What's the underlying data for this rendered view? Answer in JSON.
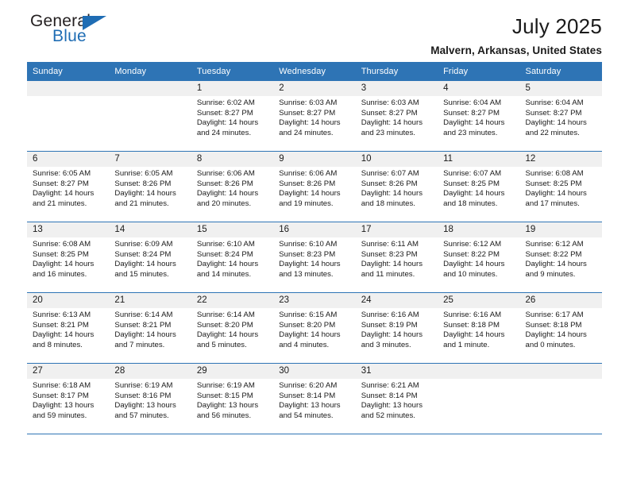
{
  "brand": {
    "name_top": "General",
    "name_bottom": "Blue",
    "color_primary": "#1f6db4"
  },
  "header": {
    "title": "July 2025",
    "subtitle": "Malvern, Arkansas, United States"
  },
  "theme": {
    "header_row_bg": "#2e74b5",
    "daynum_bg": "#f0f0f0",
    "grid_line": "#2e74b5"
  },
  "weekday_headers": [
    "Sunday",
    "Monday",
    "Tuesday",
    "Wednesday",
    "Thursday",
    "Friday",
    "Saturday"
  ],
  "labels": {
    "sunrise_prefix": "Sunrise:",
    "sunset_prefix": "Sunset:",
    "daylight_prefix": "Daylight:"
  },
  "weeks": [
    [
      {
        "day": "",
        "sunrise": "",
        "sunset": "",
        "daylight_line1": "",
        "daylight_line2": ""
      },
      {
        "day": "",
        "sunrise": "",
        "sunset": "",
        "daylight_line1": "",
        "daylight_line2": ""
      },
      {
        "day": "1",
        "sunrise": "Sunrise: 6:02 AM",
        "sunset": "Sunset: 8:27 PM",
        "daylight_line1": "Daylight: 14 hours",
        "daylight_line2": "and 24 minutes."
      },
      {
        "day": "2",
        "sunrise": "Sunrise: 6:03 AM",
        "sunset": "Sunset: 8:27 PM",
        "daylight_line1": "Daylight: 14 hours",
        "daylight_line2": "and 24 minutes."
      },
      {
        "day": "3",
        "sunrise": "Sunrise: 6:03 AM",
        "sunset": "Sunset: 8:27 PM",
        "daylight_line1": "Daylight: 14 hours",
        "daylight_line2": "and 23 minutes."
      },
      {
        "day": "4",
        "sunrise": "Sunrise: 6:04 AM",
        "sunset": "Sunset: 8:27 PM",
        "daylight_line1": "Daylight: 14 hours",
        "daylight_line2": "and 23 minutes."
      },
      {
        "day": "5",
        "sunrise": "Sunrise: 6:04 AM",
        "sunset": "Sunset: 8:27 PM",
        "daylight_line1": "Daylight: 14 hours",
        "daylight_line2": "and 22 minutes."
      }
    ],
    [
      {
        "day": "6",
        "sunrise": "Sunrise: 6:05 AM",
        "sunset": "Sunset: 8:27 PM",
        "daylight_line1": "Daylight: 14 hours",
        "daylight_line2": "and 21 minutes."
      },
      {
        "day": "7",
        "sunrise": "Sunrise: 6:05 AM",
        "sunset": "Sunset: 8:26 PM",
        "daylight_line1": "Daylight: 14 hours",
        "daylight_line2": "and 21 minutes."
      },
      {
        "day": "8",
        "sunrise": "Sunrise: 6:06 AM",
        "sunset": "Sunset: 8:26 PM",
        "daylight_line1": "Daylight: 14 hours",
        "daylight_line2": "and 20 minutes."
      },
      {
        "day": "9",
        "sunrise": "Sunrise: 6:06 AM",
        "sunset": "Sunset: 8:26 PM",
        "daylight_line1": "Daylight: 14 hours",
        "daylight_line2": "and 19 minutes."
      },
      {
        "day": "10",
        "sunrise": "Sunrise: 6:07 AM",
        "sunset": "Sunset: 8:26 PM",
        "daylight_line1": "Daylight: 14 hours",
        "daylight_line2": "and 18 minutes."
      },
      {
        "day": "11",
        "sunrise": "Sunrise: 6:07 AM",
        "sunset": "Sunset: 8:25 PM",
        "daylight_line1": "Daylight: 14 hours",
        "daylight_line2": "and 18 minutes."
      },
      {
        "day": "12",
        "sunrise": "Sunrise: 6:08 AM",
        "sunset": "Sunset: 8:25 PM",
        "daylight_line1": "Daylight: 14 hours",
        "daylight_line2": "and 17 minutes."
      }
    ],
    [
      {
        "day": "13",
        "sunrise": "Sunrise: 6:08 AM",
        "sunset": "Sunset: 8:25 PM",
        "daylight_line1": "Daylight: 14 hours",
        "daylight_line2": "and 16 minutes."
      },
      {
        "day": "14",
        "sunrise": "Sunrise: 6:09 AM",
        "sunset": "Sunset: 8:24 PM",
        "daylight_line1": "Daylight: 14 hours",
        "daylight_line2": "and 15 minutes."
      },
      {
        "day": "15",
        "sunrise": "Sunrise: 6:10 AM",
        "sunset": "Sunset: 8:24 PM",
        "daylight_line1": "Daylight: 14 hours",
        "daylight_line2": "and 14 minutes."
      },
      {
        "day": "16",
        "sunrise": "Sunrise: 6:10 AM",
        "sunset": "Sunset: 8:23 PM",
        "daylight_line1": "Daylight: 14 hours",
        "daylight_line2": "and 13 minutes."
      },
      {
        "day": "17",
        "sunrise": "Sunrise: 6:11 AM",
        "sunset": "Sunset: 8:23 PM",
        "daylight_line1": "Daylight: 14 hours",
        "daylight_line2": "and 11 minutes."
      },
      {
        "day": "18",
        "sunrise": "Sunrise: 6:12 AM",
        "sunset": "Sunset: 8:22 PM",
        "daylight_line1": "Daylight: 14 hours",
        "daylight_line2": "and 10 minutes."
      },
      {
        "day": "19",
        "sunrise": "Sunrise: 6:12 AM",
        "sunset": "Sunset: 8:22 PM",
        "daylight_line1": "Daylight: 14 hours",
        "daylight_line2": "and 9 minutes."
      }
    ],
    [
      {
        "day": "20",
        "sunrise": "Sunrise: 6:13 AM",
        "sunset": "Sunset: 8:21 PM",
        "daylight_line1": "Daylight: 14 hours",
        "daylight_line2": "and 8 minutes."
      },
      {
        "day": "21",
        "sunrise": "Sunrise: 6:14 AM",
        "sunset": "Sunset: 8:21 PM",
        "daylight_line1": "Daylight: 14 hours",
        "daylight_line2": "and 7 minutes."
      },
      {
        "day": "22",
        "sunrise": "Sunrise: 6:14 AM",
        "sunset": "Sunset: 8:20 PM",
        "daylight_line1": "Daylight: 14 hours",
        "daylight_line2": "and 5 minutes."
      },
      {
        "day": "23",
        "sunrise": "Sunrise: 6:15 AM",
        "sunset": "Sunset: 8:20 PM",
        "daylight_line1": "Daylight: 14 hours",
        "daylight_line2": "and 4 minutes."
      },
      {
        "day": "24",
        "sunrise": "Sunrise: 6:16 AM",
        "sunset": "Sunset: 8:19 PM",
        "daylight_line1": "Daylight: 14 hours",
        "daylight_line2": "and 3 minutes."
      },
      {
        "day": "25",
        "sunrise": "Sunrise: 6:16 AM",
        "sunset": "Sunset: 8:18 PM",
        "daylight_line1": "Daylight: 14 hours",
        "daylight_line2": "and 1 minute."
      },
      {
        "day": "26",
        "sunrise": "Sunrise: 6:17 AM",
        "sunset": "Sunset: 8:18 PM",
        "daylight_line1": "Daylight: 14 hours",
        "daylight_line2": "and 0 minutes."
      }
    ],
    [
      {
        "day": "27",
        "sunrise": "Sunrise: 6:18 AM",
        "sunset": "Sunset: 8:17 PM",
        "daylight_line1": "Daylight: 13 hours",
        "daylight_line2": "and 59 minutes."
      },
      {
        "day": "28",
        "sunrise": "Sunrise: 6:19 AM",
        "sunset": "Sunset: 8:16 PM",
        "daylight_line1": "Daylight: 13 hours",
        "daylight_line2": "and 57 minutes."
      },
      {
        "day": "29",
        "sunrise": "Sunrise: 6:19 AM",
        "sunset": "Sunset: 8:15 PM",
        "daylight_line1": "Daylight: 13 hours",
        "daylight_line2": "and 56 minutes."
      },
      {
        "day": "30",
        "sunrise": "Sunrise: 6:20 AM",
        "sunset": "Sunset: 8:14 PM",
        "daylight_line1": "Daylight: 13 hours",
        "daylight_line2": "and 54 minutes."
      },
      {
        "day": "31",
        "sunrise": "Sunrise: 6:21 AM",
        "sunset": "Sunset: 8:14 PM",
        "daylight_line1": "Daylight: 13 hours",
        "daylight_line2": "and 52 minutes."
      },
      {
        "day": "",
        "sunrise": "",
        "sunset": "",
        "daylight_line1": "",
        "daylight_line2": ""
      },
      {
        "day": "",
        "sunrise": "",
        "sunset": "",
        "daylight_line1": "",
        "daylight_line2": ""
      }
    ]
  ]
}
